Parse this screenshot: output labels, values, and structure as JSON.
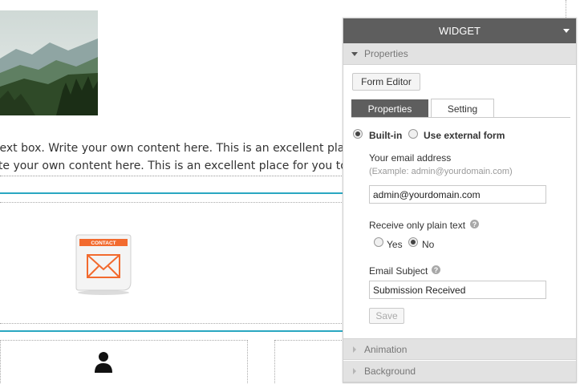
{
  "canvas": {
    "text_line_1": "text box. Write your own content here. This is an excellent place f",
    "text_line_2": "ite your own content here. This is an excellent place for you to add",
    "contact_badge": "CONTACT"
  },
  "widget": {
    "title": "WIDGET",
    "sections": {
      "properties": "Properties",
      "animation": "Animation",
      "background": "Background"
    },
    "form_editor_label": "Form Editor",
    "tabs": [
      {
        "label": "Properties",
        "active": true
      },
      {
        "label": "Setting",
        "active": false
      }
    ],
    "form_source": {
      "options": [
        {
          "label": "Built-in",
          "selected": true
        },
        {
          "label": "Use external form",
          "selected": false
        }
      ]
    },
    "email_address": {
      "label": "Your email address",
      "hint": "(Example: admin@yourdomain.com)",
      "value": "admin@yourdomain.com"
    },
    "plain_text": {
      "label": "Receive only plain text",
      "options": [
        {
          "label": "Yes",
          "selected": false
        },
        {
          "label": "No",
          "selected": true
        }
      ]
    },
    "email_subject": {
      "label": "Email Subject",
      "value": "Submission Received"
    },
    "save_label": "Save",
    "help_glyph": "?"
  },
  "colors": {
    "accent_teal": "#2aa7c1",
    "panel_header": "#5e5e5e",
    "contact_orange": "#f26a2e"
  }
}
